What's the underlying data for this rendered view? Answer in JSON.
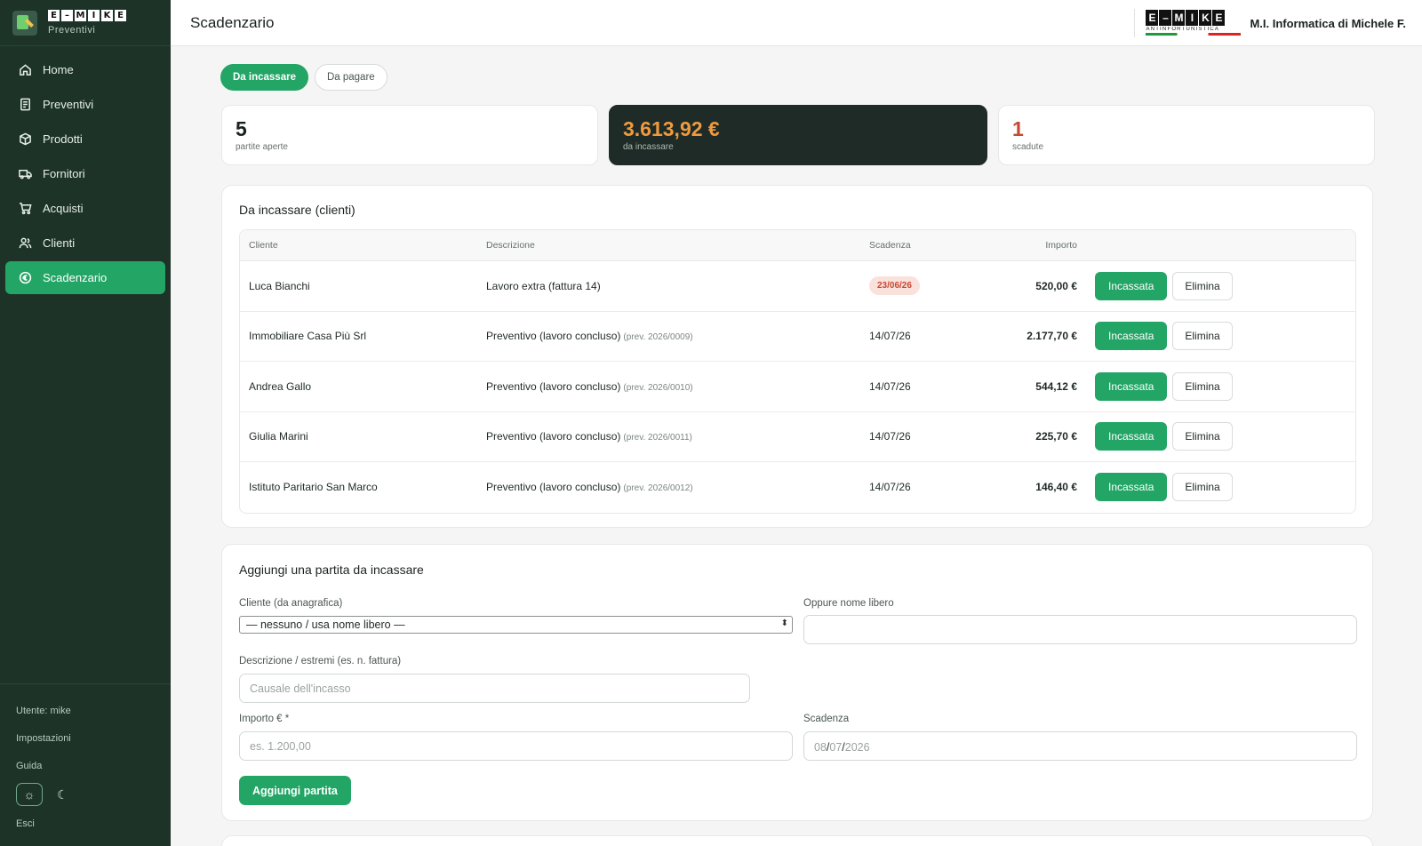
{
  "sidebar": {
    "brand": {
      "wordmark": [
        "E",
        "–",
        "M",
        "I",
        "K",
        "E"
      ],
      "subtitle": "Preventivi"
    },
    "items": [
      {
        "label": "Home",
        "icon": "home-icon"
      },
      {
        "label": "Preventivi",
        "icon": "document-icon"
      },
      {
        "label": "Prodotti",
        "icon": "box-icon"
      },
      {
        "label": "Fornitori",
        "icon": "truck-icon"
      },
      {
        "label": "Acquisti",
        "icon": "cart-icon"
      },
      {
        "label": "Clienti",
        "icon": "users-icon"
      },
      {
        "label": "Scadenzario",
        "icon": "coin-icon",
        "active": true
      }
    ],
    "user": "Utente: mike",
    "settings": "Impostazioni",
    "guide": "Guida",
    "theme": {
      "light_icon": "sun-icon",
      "dark_icon": "moon-icon",
      "selected": "light"
    },
    "logout": "Esci"
  },
  "header": {
    "title": "Scadenzario",
    "company_logo": {
      "letters": [
        "E",
        "–",
        "M",
        "I",
        "K",
        "E"
      ],
      "tagline": "ANTINFORTUNISTICA"
    },
    "company_name": "M.I. Informatica di Michele F."
  },
  "tabs": [
    {
      "label": "Da incassare",
      "active": true
    },
    {
      "label": "Da pagare",
      "active": false
    }
  ],
  "stats": [
    {
      "value": "5",
      "label": "partite aperte"
    },
    {
      "value": "3.613,92 €",
      "label": "da incassare"
    },
    {
      "value": "1",
      "label": "scadute"
    }
  ],
  "receivables": {
    "title": "Da incassare (clienti)",
    "columns": [
      "Cliente",
      "Descrizione",
      "Scadenza",
      "Importo"
    ],
    "rows": [
      {
        "cliente": "Luca Bianchi",
        "descrizione": "Lavoro extra (fattura 14)",
        "ref": "",
        "scadenza": "23/06/26",
        "overdue": true,
        "importo": "520,00 €"
      },
      {
        "cliente": "Immobiliare Casa Più Srl",
        "descrizione": "Preventivo (lavoro concluso)",
        "ref": "(prev. 2026/0009)",
        "scadenza": "14/07/26",
        "overdue": false,
        "importo": "2.177,70 €"
      },
      {
        "cliente": "Andrea Gallo",
        "descrizione": "Preventivo (lavoro concluso)",
        "ref": "(prev. 2026/0010)",
        "scadenza": "14/07/26",
        "overdue": false,
        "importo": "544,12 €"
      },
      {
        "cliente": "Giulia Marini",
        "descrizione": "Preventivo (lavoro concluso)",
        "ref": "(prev. 2026/0011)",
        "scadenza": "14/07/26",
        "overdue": false,
        "importo": "225,70 €"
      },
      {
        "cliente": "Istituto Paritario San Marco",
        "descrizione": "Preventivo (lavoro concluso)",
        "ref": "(prev. 2026/0012)",
        "scadenza": "14/07/26",
        "overdue": false,
        "importo": "146,40 €"
      }
    ],
    "action_primary": "Incassata",
    "action_secondary": "Elimina"
  },
  "form": {
    "title": "Aggiungi una partita da incassare",
    "cliente_label": "Cliente (da anagrafica)",
    "cliente_value": "— nessuno / usa nome libero —",
    "nome_label": "Oppure nome libero",
    "nome_value": "",
    "descrizione_label": "Descrizione / estremi (es. n. fattura)",
    "descrizione_placeholder": "Causale dell'incasso",
    "importo_label": "Importo € *",
    "importo_placeholder": "es. 1.200,00",
    "scadenza_label": "Scadenza",
    "scadenza_dd": "08",
    "scadenza_mm": "07",
    "scadenza_yyyy": "2026",
    "submit_label": "Aggiungi partita"
  },
  "colors": {
    "accent": "#22a565",
    "sidebar": "#1d3328",
    "warning": "#f09a3e",
    "danger": "#c44a32"
  }
}
